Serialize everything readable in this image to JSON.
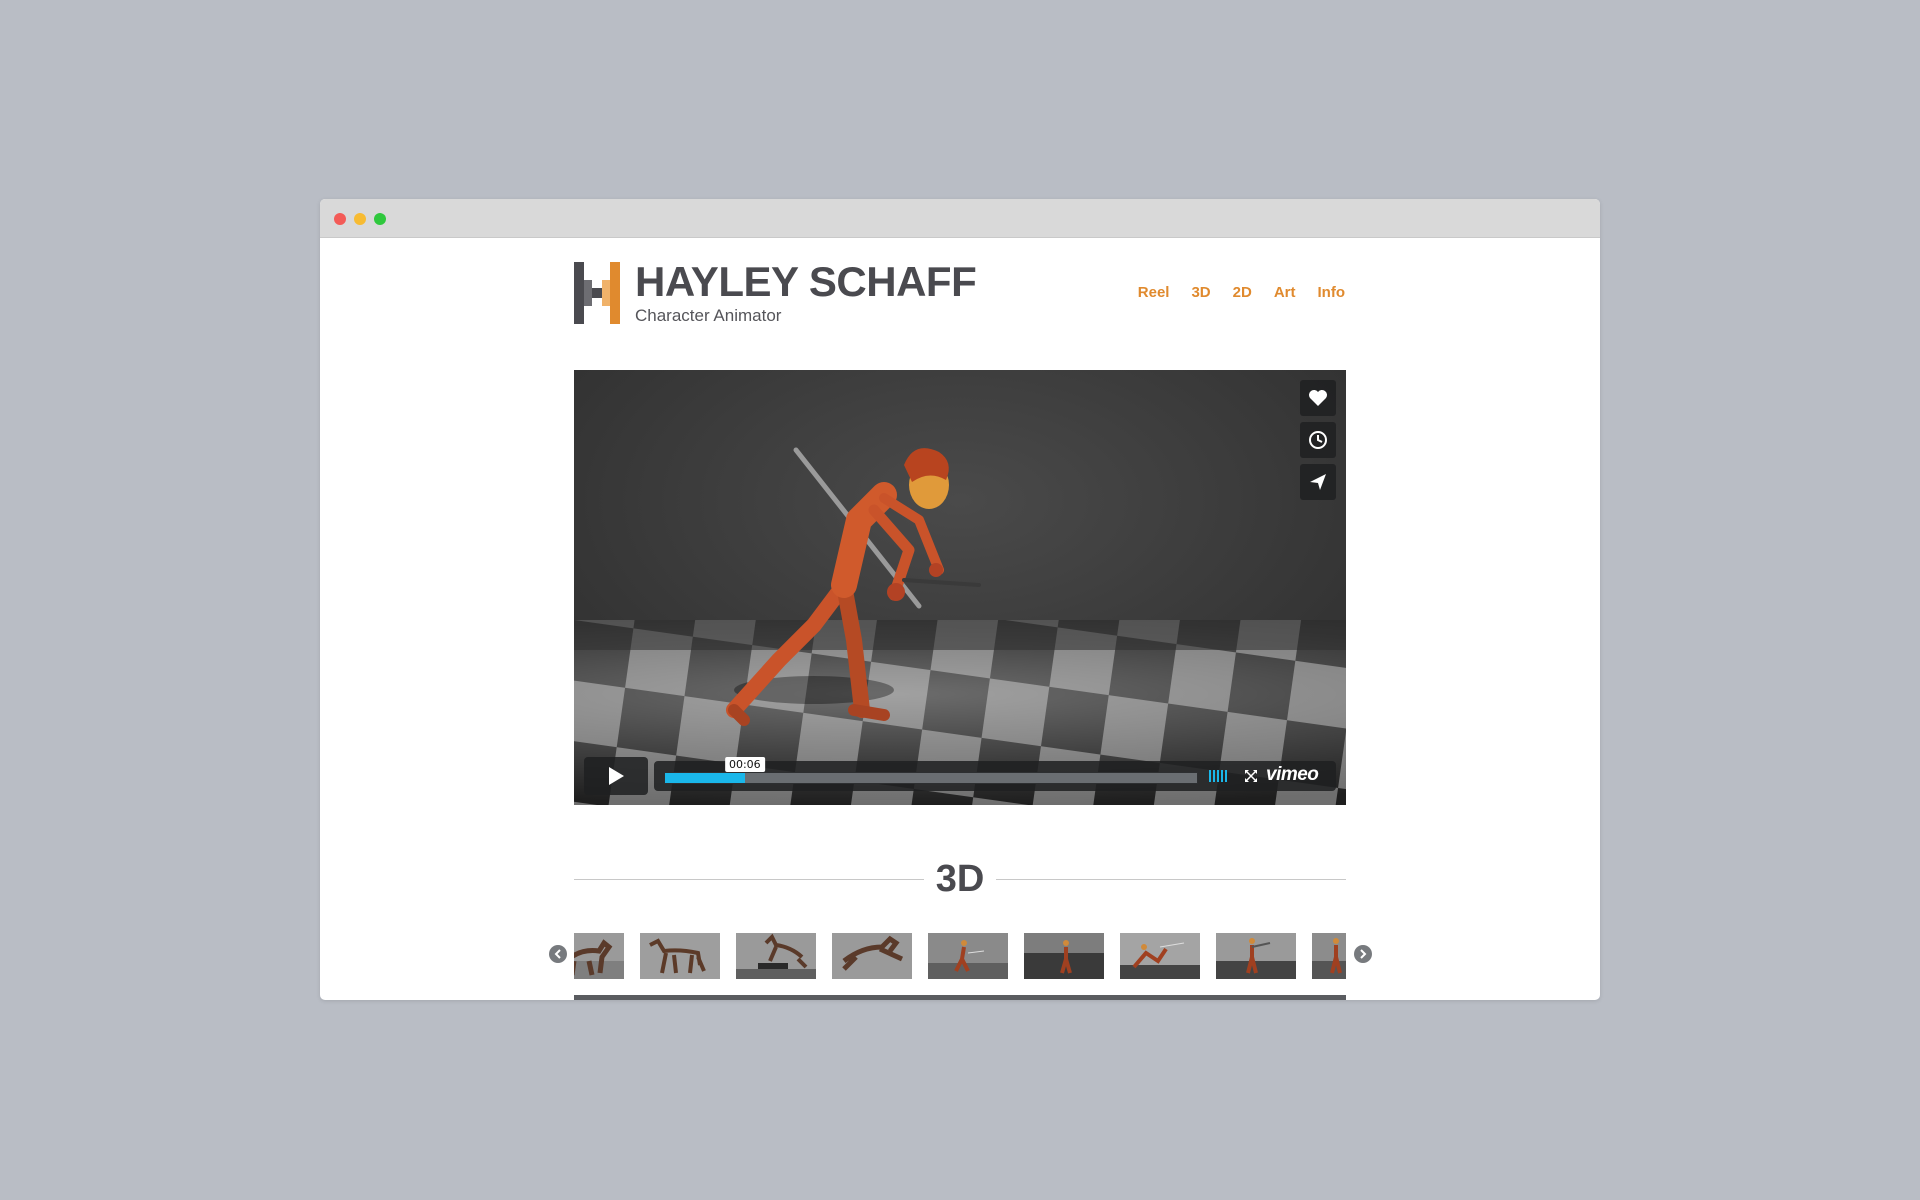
{
  "site": {
    "title": "HAYLEY SCHAFF",
    "subtitle": "Character Animator",
    "brand_color": "#e08a2e",
    "text_color": "#4a4a4f"
  },
  "nav": [
    {
      "label": "Reel"
    },
    {
      "label": "3D"
    },
    {
      "label": "2D"
    },
    {
      "label": "Art"
    },
    {
      "label": "Info"
    }
  ],
  "player": {
    "time_tooltip": "00:06",
    "played_fraction": 0.15,
    "loaded_fraction": 1.0,
    "accent_color": "#1ab7ea",
    "brand": "vimeo",
    "side_buttons": [
      "heart-icon",
      "clock-icon",
      "paper-plane-icon"
    ]
  },
  "section": {
    "title": "3D"
  },
  "carousel": {
    "thumbnails": [
      {
        "subject": "horse"
      },
      {
        "subject": "horse"
      },
      {
        "subject": "horse-jumping"
      },
      {
        "subject": "horse-leaping"
      },
      {
        "subject": "character-sword",
        "active": true
      },
      {
        "subject": "character"
      },
      {
        "subject": "character-lunge"
      },
      {
        "subject": "character-standing"
      },
      {
        "subject": "character"
      }
    ]
  }
}
